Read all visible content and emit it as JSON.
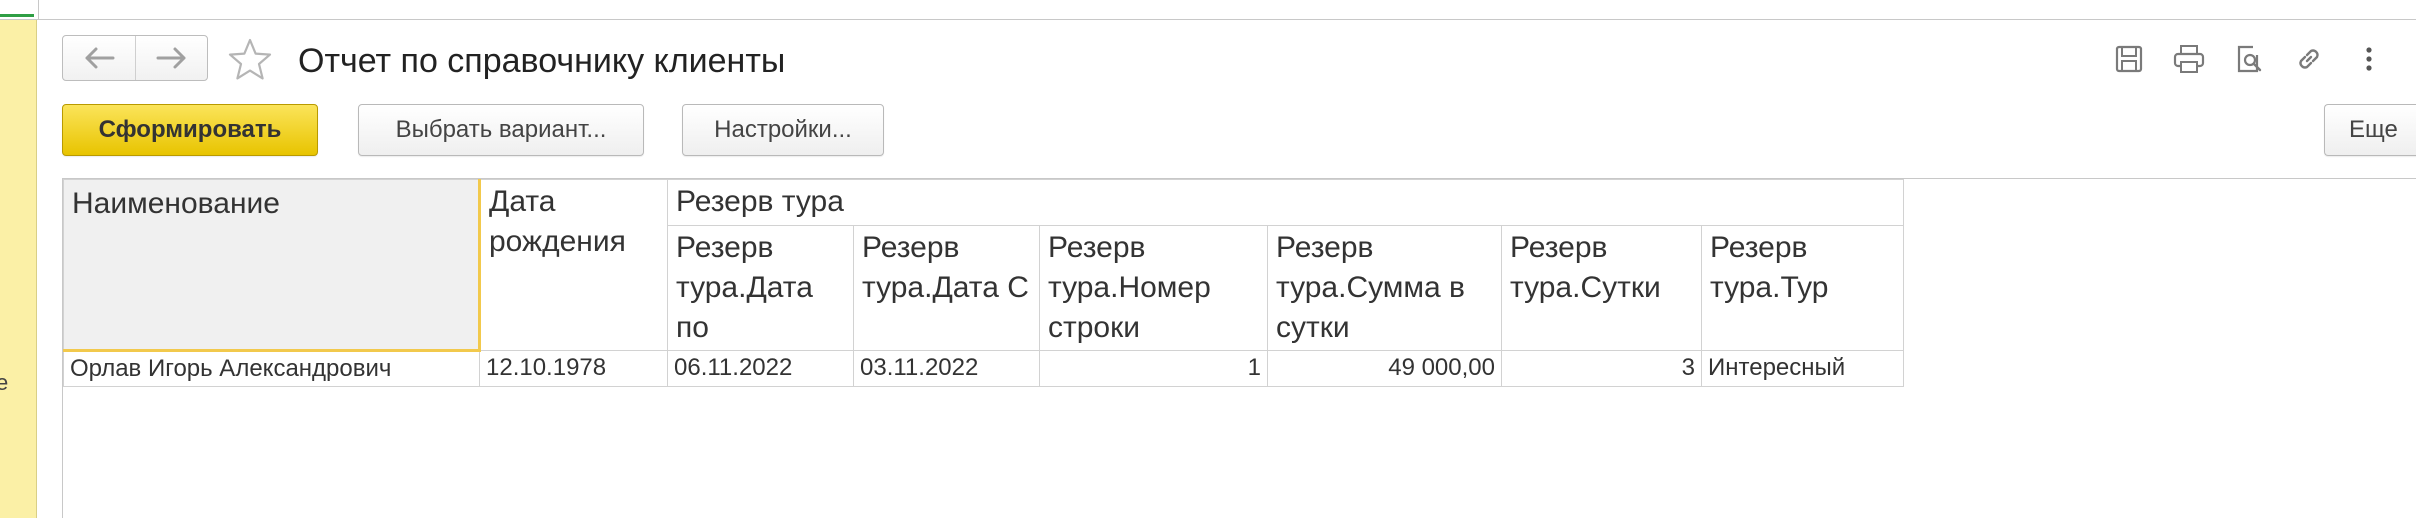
{
  "window": {
    "title": "Отчет по справочнику клиенты",
    "side_fragment": "е"
  },
  "toolbar": {
    "back_icon": "arrow-left-icon",
    "forward_icon": "arrow-right-icon",
    "favorite_icon": "star-icon",
    "icons": [
      "save-icon",
      "print-icon",
      "preview-icon",
      "link-icon",
      "more-vertical-icon"
    ]
  },
  "commands": {
    "generate_label": "Сформировать",
    "variant_label": "Выбрать вариант...",
    "settings_label": "Настройки...",
    "more_label": "Еще"
  },
  "report": {
    "headers": {
      "name": "Наименование",
      "birth_date": "Дата рождения",
      "group": "Резерв тура",
      "sub": [
        "Резерв тура.Дата по",
        "Резерв тура.Дата С",
        "Резерв тура.Номер строки",
        "Резерв тура.Сумма в сутки",
        "Резерв тура.Сутки",
        "Резерв тура.Тур"
      ]
    },
    "rows": [
      {
        "name": "Орлав Игорь Александрович",
        "birth_date": "12.10.1978",
        "date_to": "06.11.2022",
        "date_from": "03.11.2022",
        "line_no": "1",
        "sum_per_day": "49 000,00",
        "days": "3",
        "tour": "Интересный"
      }
    ]
  },
  "colors": {
    "accent_button": "#f4d21c",
    "sidebar": "#fbf0a6",
    "selection_border": "#f2c94c"
  }
}
